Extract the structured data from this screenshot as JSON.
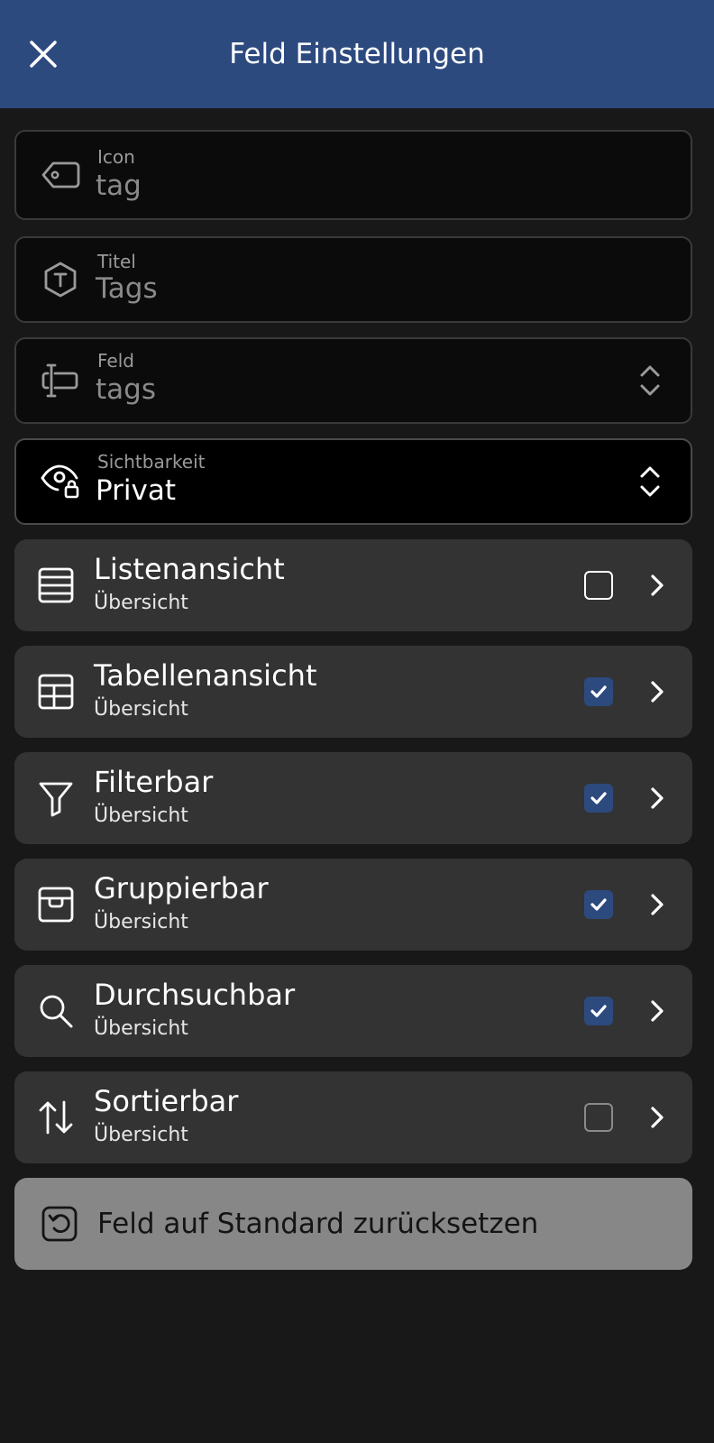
{
  "header": {
    "title": "Feld Einstellungen"
  },
  "fields": {
    "icon": {
      "label": "Icon",
      "value": "tag"
    },
    "titel": {
      "label": "Titel",
      "value": "Tags"
    },
    "feld": {
      "label": "Feld",
      "value": "tags"
    },
    "sichtbarkeit": {
      "label": "Sichtbarkeit",
      "value": "Privat"
    }
  },
  "options": [
    {
      "title": "Listenansicht",
      "subtitle": "Übersicht",
      "checked": false,
      "icon": "list-icon"
    },
    {
      "title": "Tabellenansicht",
      "subtitle": "Übersicht",
      "checked": true,
      "icon": "table-icon"
    },
    {
      "title": "Filterbar",
      "subtitle": "Übersicht",
      "checked": true,
      "icon": "filter-icon"
    },
    {
      "title": "Gruppierbar",
      "subtitle": "Übersicht",
      "checked": true,
      "icon": "archive-icon"
    },
    {
      "title": "Durchsuchbar",
      "subtitle": "Übersicht",
      "checked": true,
      "icon": "search-icon"
    },
    {
      "title": "Sortierbar",
      "subtitle": "Übersicht",
      "checked": false,
      "icon": "sort-icon"
    }
  ],
  "reset": {
    "label": "Feld auf Standard zurücksetzen"
  },
  "colors": {
    "header": "#2d4a7f",
    "background": "#181818",
    "row": "#333333",
    "reset": "#878787",
    "accent": "#2d4a7f"
  }
}
